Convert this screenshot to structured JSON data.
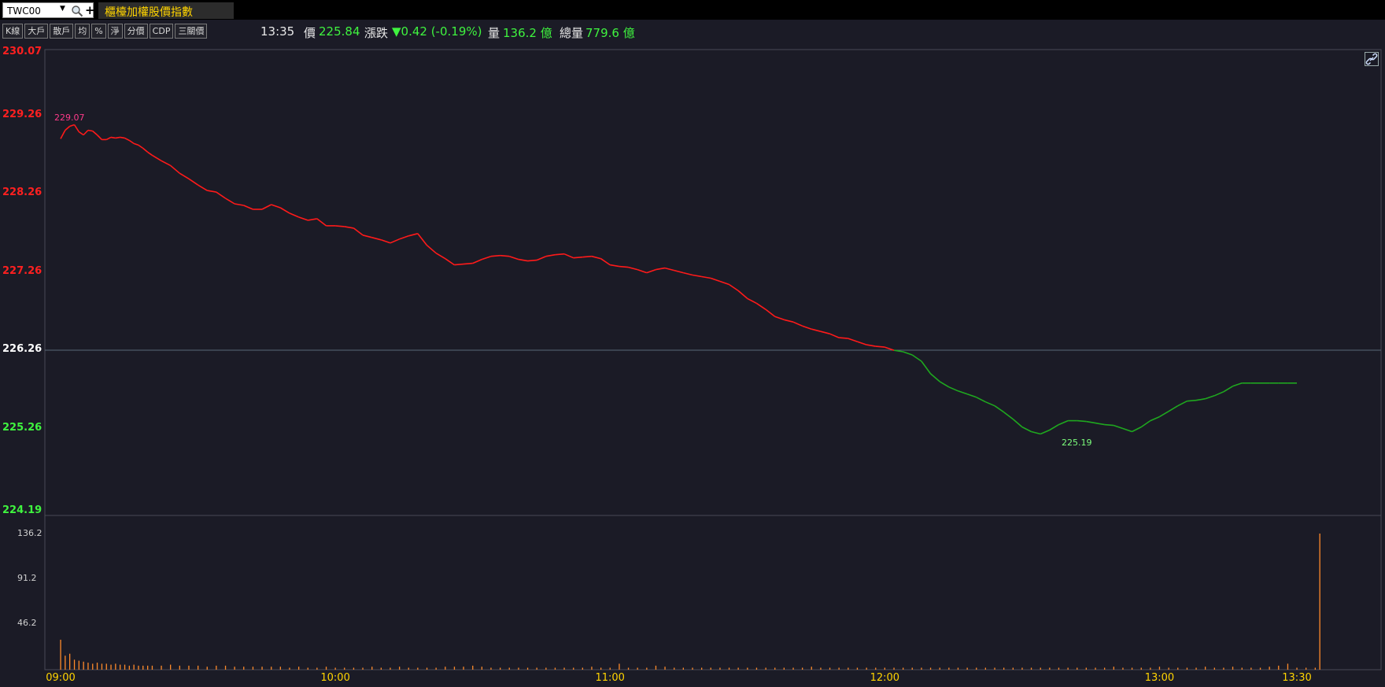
{
  "symbol": {
    "value": "TWC00"
  },
  "title": "櫃檯加權股價指數",
  "toolbar": [
    "K線",
    "大戶",
    "散戶",
    "均",
    "%",
    "淨",
    "分價",
    "CDP",
    "三關價"
  ],
  "quote": {
    "time": "13:35",
    "price_label": "價",
    "price": "225.84",
    "change_label": "漲跌",
    "change": "▼0.42 (-0.19%)",
    "volume_label": "量",
    "volume": "136.2 億",
    "total_label": "總量",
    "total": "779.6 億"
  },
  "price_axis": [
    {
      "label": "230.07",
      "value": 230.07,
      "color": "#ff2020"
    },
    {
      "label": "229.26",
      "value": 229.26,
      "color": "#ff2020"
    },
    {
      "label": "228.26",
      "value": 228.26,
      "color": "#ff2020"
    },
    {
      "label": "227.26",
      "value": 227.26,
      "color": "#ff2020"
    },
    {
      "label": "226.26",
      "value": 226.26,
      "color": "#ffffff"
    },
    {
      "label": "225.26",
      "value": 225.26,
      "color": "#3ff33f"
    },
    {
      "label": "224.19",
      "value": 224.19,
      "color": "#3ff33f"
    }
  ],
  "volume_axis": [
    {
      "label": "136.2",
      "value": 136.2
    },
    {
      "label": "91.2",
      "value": 91.2
    },
    {
      "label": "46.2",
      "value": 46.2
    }
  ],
  "time_axis": [
    {
      "label": "09:00",
      "minute": 0
    },
    {
      "label": "10:00",
      "minute": 60
    },
    {
      "label": "11:00",
      "minute": 120
    },
    {
      "label": "12:00",
      "minute": 180
    },
    {
      "label": "13:00",
      "minute": 240
    },
    {
      "label": "13:30",
      "minute": 270
    }
  ],
  "annotations": {
    "high": {
      "label": "229.07",
      "value": 229.07,
      "minute": 2
    },
    "low": {
      "label": "225.19",
      "value": 225.19,
      "minute": 222
    }
  },
  "colors": {
    "up": "#ff1a1a",
    "down": "#1fa81f",
    "volume": "#ff8a2a",
    "ref_line": "#5a6a78",
    "axis_yellow": "#ffd400"
  },
  "chart_data": [
    {
      "type": "line",
      "title": "",
      "reference": 226.26,
      "ylim": [
        224.19,
        230.07
      ],
      "xlim_minutes": [
        0,
        275
      ],
      "x_minutes": [
        0,
        1,
        2,
        3,
        4,
        5,
        6,
        7,
        8,
        9,
        10,
        11,
        12,
        13,
        14,
        15,
        16,
        17,
        18,
        19,
        20,
        22,
        24,
        26,
        28,
        30,
        32,
        34,
        36,
        38,
        40,
        42,
        44,
        46,
        48,
        50,
        52,
        54,
        56,
        58,
        60,
        62,
        64,
        66,
        68,
        70,
        72,
        74,
        76,
        78,
        80,
        82,
        84,
        86,
        88,
        90,
        92,
        94,
        96,
        98,
        100,
        102,
        104,
        106,
        108,
        110,
        112,
        114,
        116,
        118,
        120,
        122,
        124,
        126,
        128,
        130,
        132,
        134,
        136,
        138,
        140,
        142,
        144,
        146,
        148,
        150,
        152,
        154,
        156,
        158,
        160,
        162,
        164,
        166,
        168,
        170,
        172,
        174,
        176,
        178,
        180,
        182,
        184,
        186,
        188,
        190,
        192,
        194,
        196,
        198,
        200,
        202,
        204,
        206,
        208,
        210,
        212,
        214,
        216,
        218,
        220,
        222,
        224,
        226,
        228,
        230,
        232,
        234,
        236,
        238,
        240,
        242,
        244,
        246,
        248,
        250,
        252,
        254,
        256,
        258,
        260,
        262,
        264,
        266,
        268,
        270,
        272,
        274
      ],
      "values": [
        228.96,
        229.07,
        229.12,
        229.14,
        229.05,
        229.01,
        229.07,
        229.06,
        229.01,
        228.95,
        228.95,
        228.98,
        228.97,
        228.98,
        228.97,
        228.94,
        228.9,
        228.88,
        228.84,
        228.79,
        228.75,
        228.68,
        228.62,
        228.52,
        228.45,
        228.37,
        228.3,
        228.28,
        228.2,
        228.13,
        228.11,
        228.06,
        228.06,
        228.12,
        228.08,
        228.01,
        227.96,
        227.92,
        227.94,
        227.85,
        227.85,
        227.84,
        227.82,
        227.73,
        227.7,
        227.67,
        227.63,
        227.68,
        227.72,
        227.75,
        227.6,
        227.5,
        227.43,
        227.35,
        227.36,
        227.37,
        227.42,
        227.46,
        227.47,
        227.46,
        227.42,
        227.4,
        227.41,
        227.46,
        227.48,
        227.49,
        227.44,
        227.45,
        227.46,
        227.43,
        227.35,
        227.33,
        227.32,
        227.29,
        227.25,
        227.29,
        227.31,
        227.28,
        227.25,
        227.22,
        227.2,
        227.18,
        227.14,
        227.1,
        227.02,
        226.92,
        226.86,
        226.78,
        226.69,
        226.65,
        226.62,
        226.57,
        226.53,
        226.5,
        226.47,
        226.42,
        226.41,
        226.37,
        226.33,
        226.31,
        226.3,
        226.26,
        226.24,
        226.2,
        226.12,
        225.96,
        225.86,
        225.79,
        225.74,
        225.7,
        225.66,
        225.6,
        225.55,
        225.47,
        225.38,
        225.28,
        225.22,
        225.19,
        225.24,
        225.31,
        225.36,
        225.36,
        225.35,
        225.33,
        225.31,
        225.3,
        225.26,
        225.22,
        225.28,
        225.36,
        225.41,
        225.48,
        225.55,
        225.61,
        225.62,
        225.64,
        225.68,
        225.73,
        225.8,
        225.84,
        225.84,
        225.84,
        225.84,
        225.84,
        225.84,
        225.84
      ]
    },
    {
      "type": "bar",
      "title": "",
      "ylabel": "億",
      "ylim": [
        0,
        136.2
      ],
      "x_minutes": [
        0,
        1,
        2,
        3,
        4,
        5,
        6,
        7,
        8,
        9,
        10,
        11,
        12,
        13,
        14,
        15,
        16,
        17,
        18,
        19,
        20,
        22,
        24,
        26,
        28,
        30,
        32,
        34,
        36,
        38,
        40,
        42,
        44,
        46,
        48,
        50,
        52,
        54,
        56,
        58,
        60,
        62,
        64,
        66,
        68,
        70,
        72,
        74,
        76,
        78,
        80,
        82,
        84,
        86,
        88,
        90,
        92,
        94,
        96,
        98,
        100,
        102,
        104,
        106,
        108,
        110,
        112,
        114,
        116,
        118,
        120,
        122,
        124,
        126,
        128,
        130,
        132,
        134,
        136,
        138,
        140,
        142,
        144,
        146,
        148,
        150,
        152,
        154,
        156,
        158,
        160,
        162,
        164,
        166,
        168,
        170,
        172,
        174,
        176,
        178,
        180,
        182,
        184,
        186,
        188,
        190,
        192,
        194,
        196,
        198,
        200,
        202,
        204,
        206,
        208,
        210,
        212,
        214,
        216,
        218,
        220,
        222,
        224,
        226,
        228,
        230,
        232,
        234,
        236,
        238,
        240,
        242,
        244,
        246,
        248,
        250,
        252,
        254,
        256,
        258,
        260,
        262,
        264,
        266,
        268,
        270,
        272,
        274,
        275
      ],
      "values": [
        30,
        14,
        16,
        10,
        9,
        8,
        7,
        6,
        7,
        6,
        6,
        5,
        6,
        5,
        5,
        4,
        5,
        4,
        4,
        4,
        4,
        4,
        5,
        4,
        4,
        4,
        3,
        4,
        4,
        3,
        3,
        3,
        3,
        3,
        3,
        2,
        3,
        2,
        2,
        3,
        2,
        2,
        2,
        2,
        3,
        2,
        2,
        3,
        2,
        2,
        2,
        2,
        3,
        3,
        3,
        4,
        3,
        2,
        2,
        2,
        2,
        2,
        2,
        2,
        2,
        2,
        2,
        2,
        3,
        2,
        2,
        6,
        2,
        2,
        2,
        4,
        3,
        2,
        2,
        2,
        2,
        2,
        2,
        2,
        2,
        2,
        2,
        2,
        2,
        2,
        2,
        2,
        3,
        2,
        2,
        2,
        2,
        2,
        2,
        2,
        2,
        2,
        2,
        2,
        2,
        2,
        2,
        2,
        2,
        2,
        2,
        2,
        2,
        2,
        2,
        2,
        2,
        2,
        2,
        2,
        2,
        2,
        2,
        2,
        2,
        3,
        2,
        2,
        2,
        2,
        3,
        2,
        2,
        2,
        2,
        3,
        2,
        2,
        3,
        2,
        2,
        2,
        3,
        4,
        6,
        2,
        2,
        2,
        136.2
      ]
    }
  ]
}
